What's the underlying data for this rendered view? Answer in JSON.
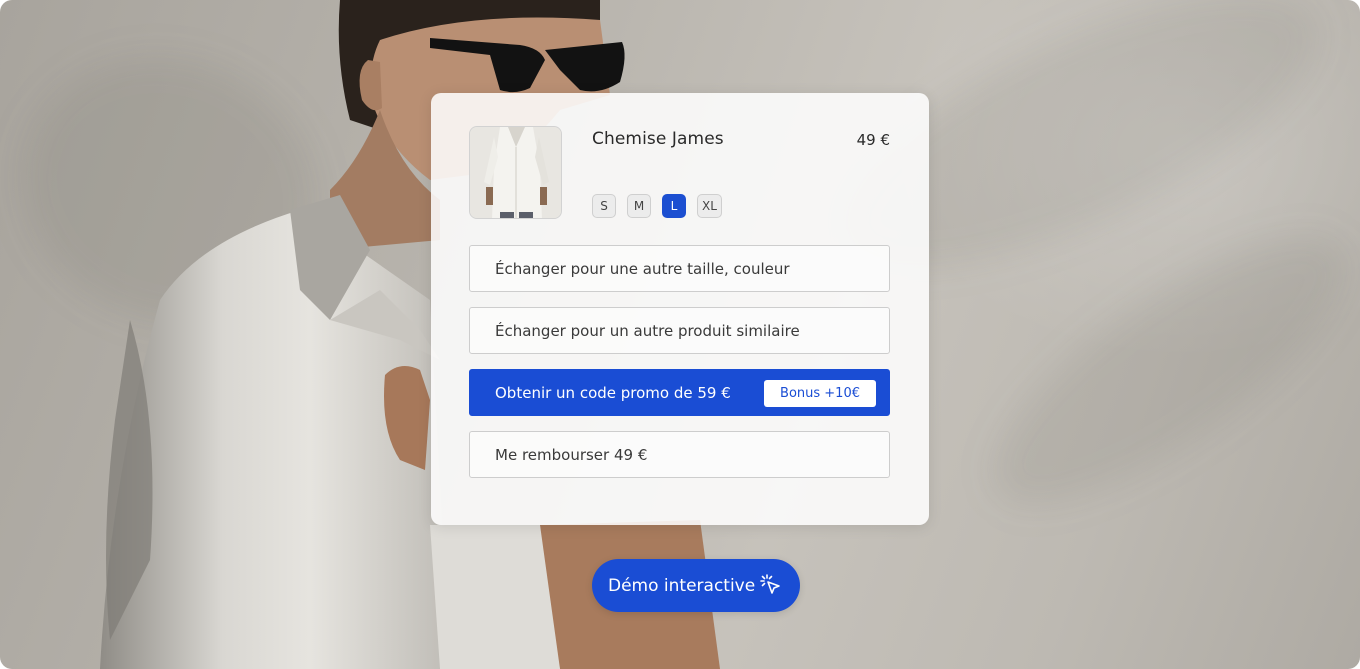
{
  "product": {
    "name": "Chemise James",
    "price": "49 €",
    "image_alt": "shirt-thumbnail"
  },
  "sizes": [
    {
      "label": "S",
      "selected": false
    },
    {
      "label": "M",
      "selected": false
    },
    {
      "label": "L",
      "selected": true
    },
    {
      "label": "XL",
      "selected": false
    }
  ],
  "options": {
    "exchange_size": "Échanger pour une autre taille, couleur",
    "exchange_product": "Échanger pour un autre produit similaire",
    "promo_code": "Obtenir un code promo de 59 €",
    "bonus_badge": "Bonus +10€",
    "refund": "Me rembourser 49 €"
  },
  "demo": {
    "label": "Démo interactive",
    "icon": "cursor-click-icon"
  },
  "colors": {
    "accent": "#1a4dd4",
    "card_bg": "#ffffff",
    "background": "#bcb8b1"
  }
}
